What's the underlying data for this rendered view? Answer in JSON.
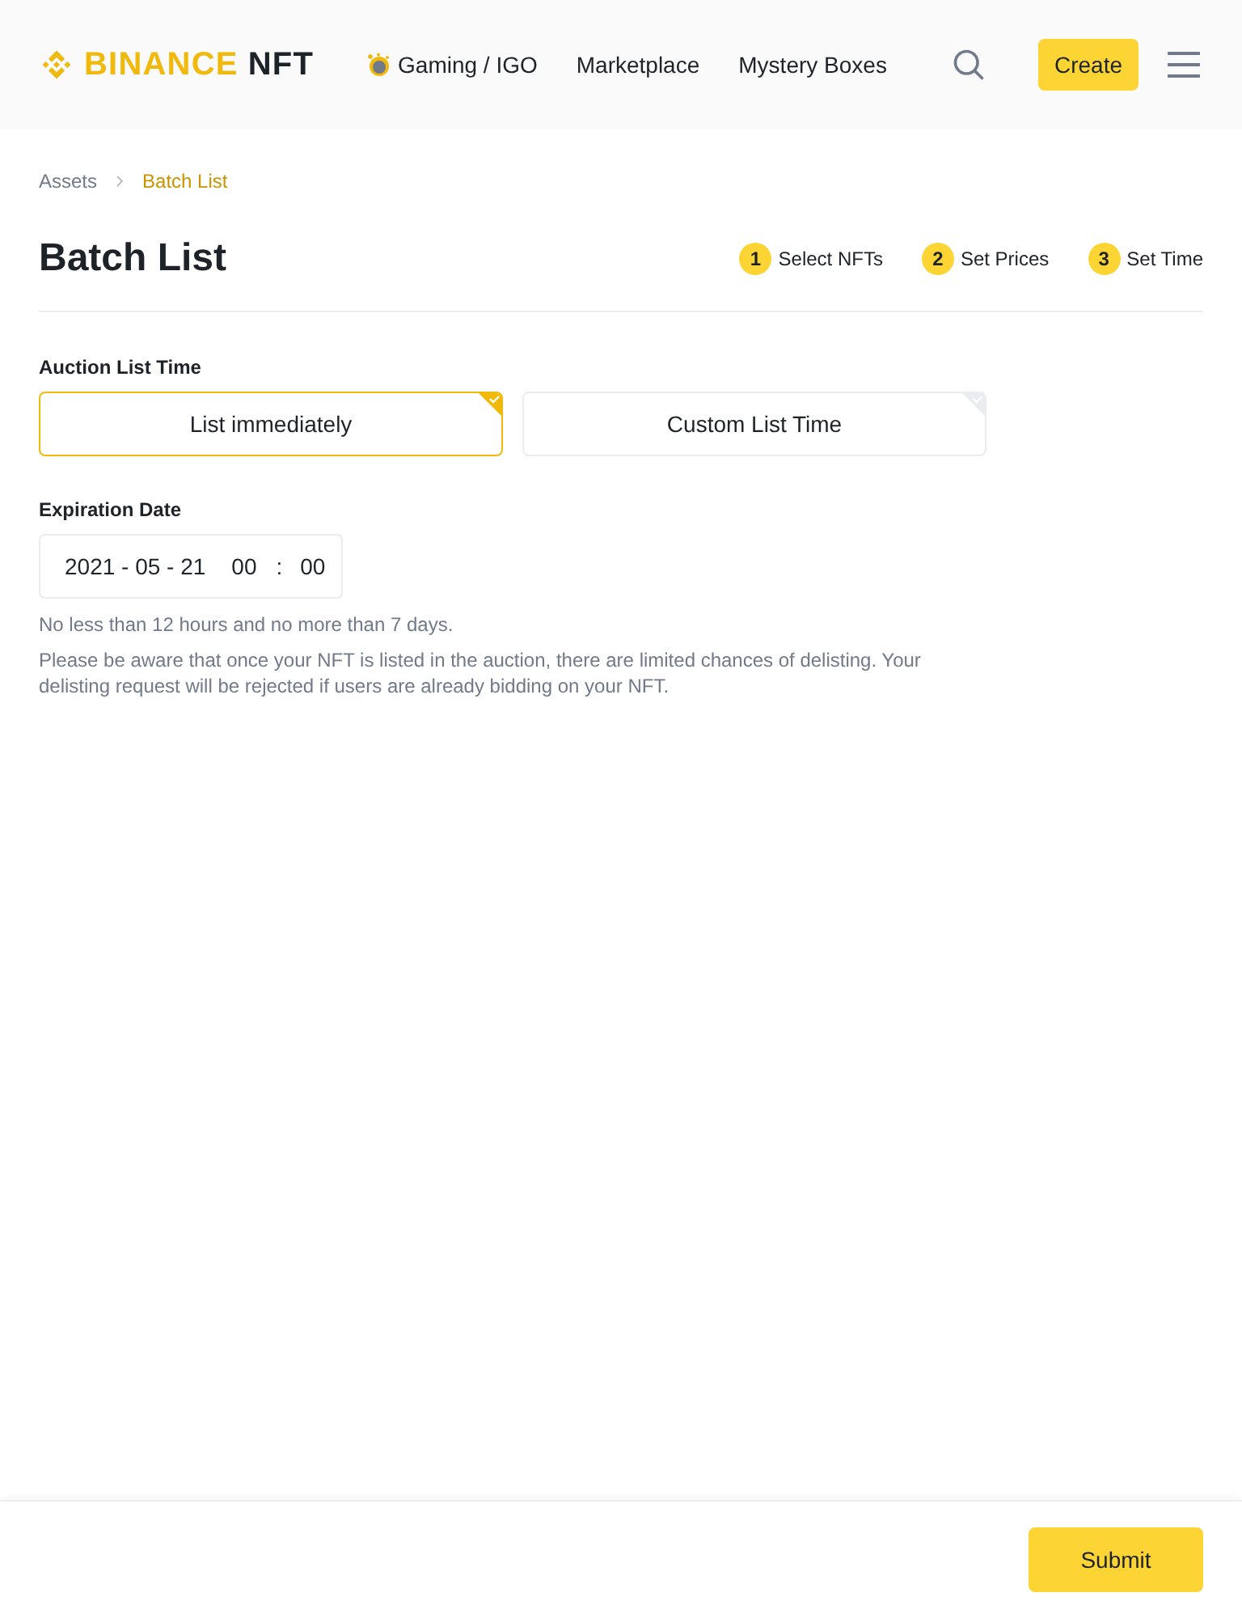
{
  "header": {
    "logo": {
      "brand": "BINANCE",
      "product": "NFT"
    },
    "nav": [
      {
        "label": "Gaming / IGO",
        "kind": "with_icon"
      },
      {
        "label": "Marketplace",
        "kind": "plain"
      },
      {
        "label": "Mystery Boxes",
        "kind": "plain"
      }
    ],
    "create_button": "Create"
  },
  "breadcrumb": [
    {
      "label": "Assets",
      "selected": false
    },
    {
      "label": "Batch List",
      "selected": true
    }
  ],
  "page_title": "Batch List",
  "steps": [
    {
      "number": "1",
      "label": "Select NFTs"
    },
    {
      "number": "2",
      "label": "Set Prices"
    },
    {
      "number": "3",
      "label": "Set Time"
    }
  ],
  "auction_list_time": {
    "label": "Auction List Time",
    "options": [
      {
        "label": "List immediately",
        "selected": true
      },
      {
        "label": "Custom List Time",
        "selected": false
      }
    ]
  },
  "expiration_date": {
    "label": "Expiration Date",
    "date": "2021 - 05 - 21",
    "hour": "00",
    "separator": ":",
    "minute": "00"
  },
  "hints": [
    "No less than 12 hours and no more than 7 days.",
    "Please be aware that once your NFT is listed in the auction, there are limited chances of delisting. Your delisting request will be rejected if users are already bidding on your NFT."
  ],
  "footer": {
    "submit_button": "Submit"
  }
}
